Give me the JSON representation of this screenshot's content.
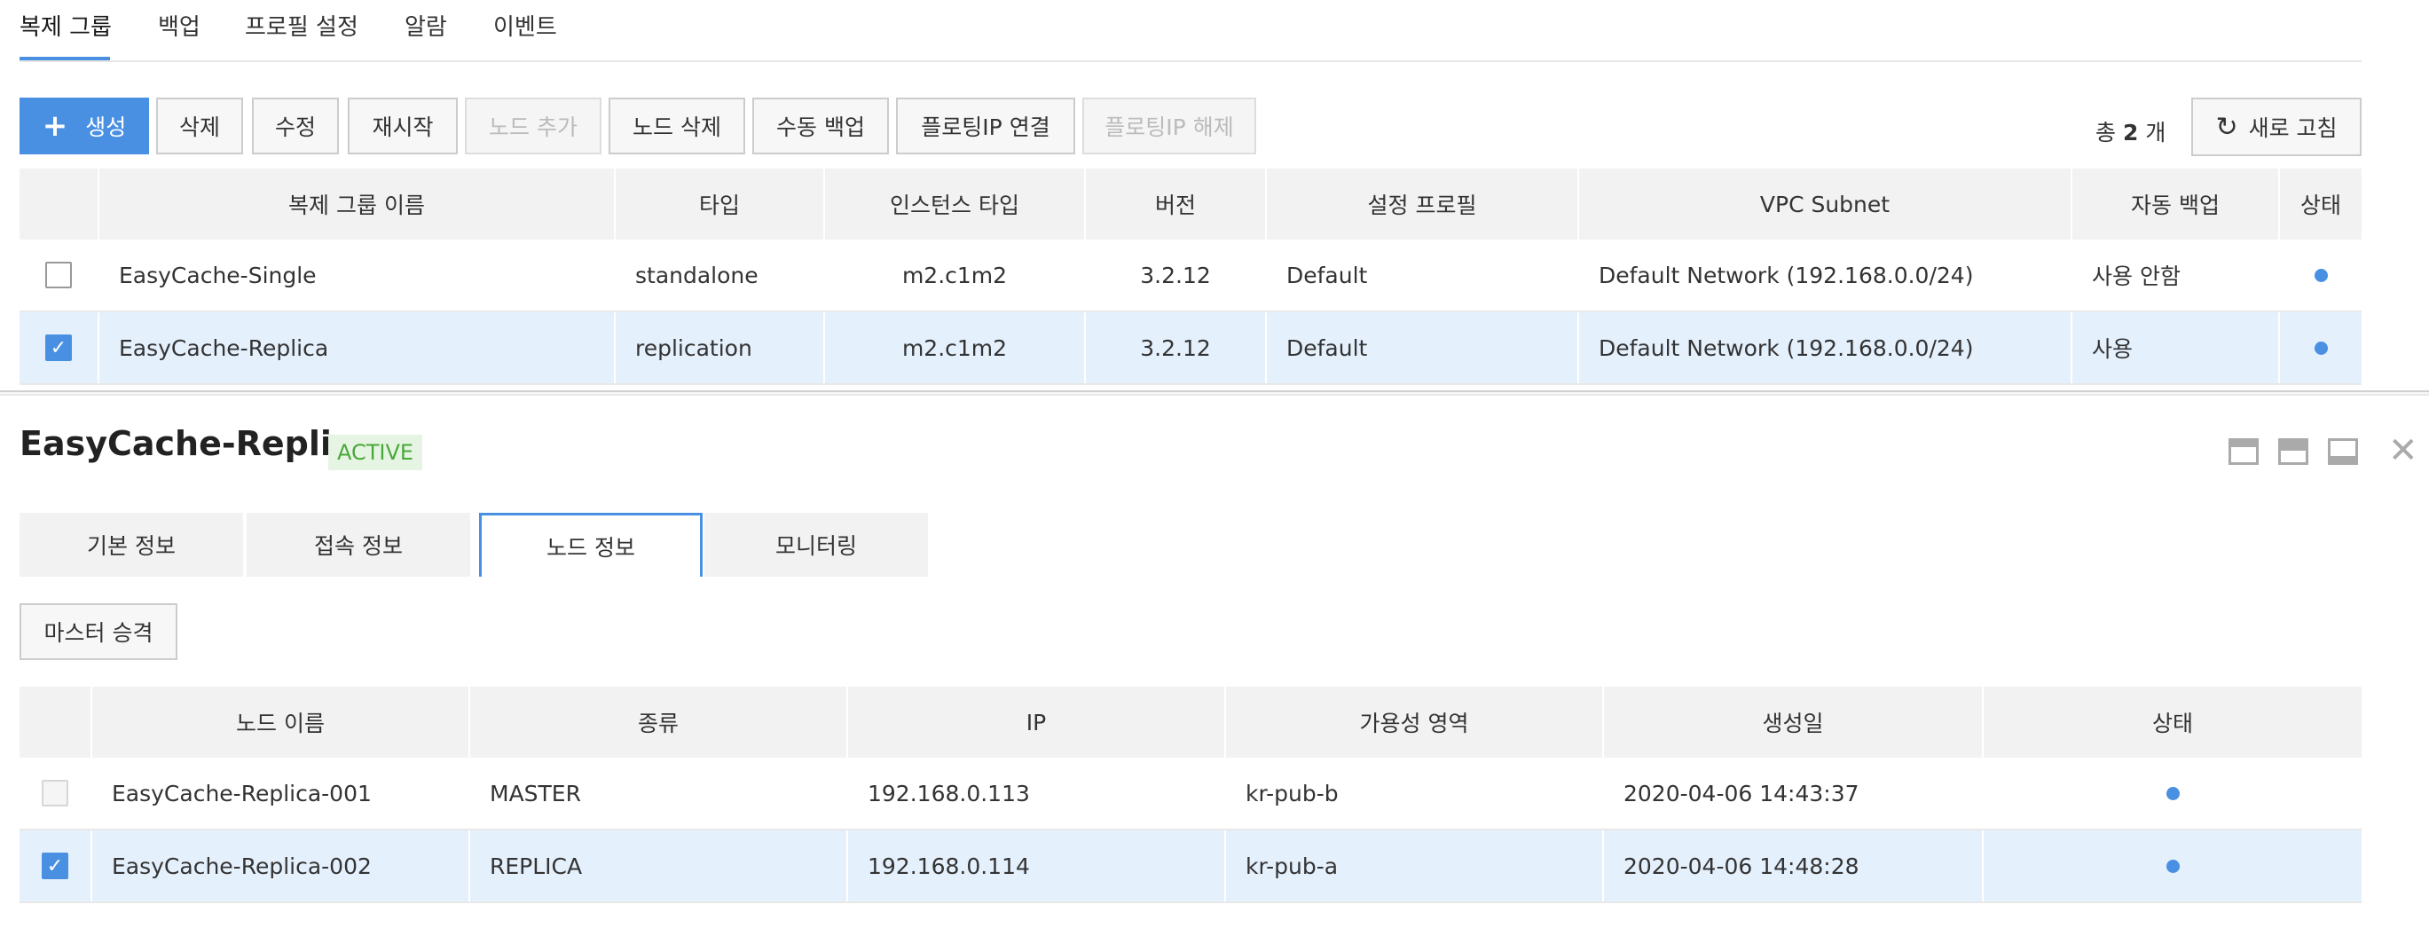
{
  "top_tabs": [
    "복제 그룹",
    "백업",
    "프로필 설정",
    "알람",
    "이벤트"
  ],
  "toolbar": {
    "create": "생성",
    "delete": "삭제",
    "edit": "수정",
    "restart": "재시작",
    "add_node": "노드 추가",
    "delete_node": "노드 삭제",
    "manual_backup": "수동 백업",
    "floating_ip_connect": "플로팅IP 연결",
    "floating_ip_disconnect": "플로팅IP 해제",
    "total_prefix": "총",
    "total_count": "2",
    "total_suffix": "개",
    "refresh": "새로 고침"
  },
  "group_table": {
    "headers": [
      "복제 그룹 이름",
      "타입",
      "인스턴스 타입",
      "버전",
      "설정 프로필",
      "VPC Subnet",
      "자동 백업",
      "상태"
    ],
    "rows": [
      {
        "name": "EasyCache-Single",
        "type": "standalone",
        "instance_type": "m2.c1m2",
        "version": "3.2.12",
        "profile": "Default",
        "subnet": "Default Network (192.168.0.0/24)",
        "auto_backup": "사용 안함",
        "checked": false
      },
      {
        "name": "EasyCache-Replica",
        "type": "replication",
        "instance_type": "m2.c1m2",
        "version": "3.2.12",
        "profile": "Default",
        "subnet": "Default Network (192.168.0.0/24)",
        "auto_backup": "사용",
        "checked": true
      }
    ]
  },
  "detail": {
    "title": "EasyCache-Replica",
    "status": "ACTIVE",
    "tabs": [
      "기본 정보",
      "접속 정보",
      "노드 정보",
      "모니터링"
    ],
    "active_tab": "노드 정보",
    "promote_button": "마스터 승격"
  },
  "node_table": {
    "headers": [
      "노드 이름",
      "종류",
      "IP",
      "가용성 영역",
      "생성일",
      "상태"
    ],
    "rows": [
      {
        "name": "EasyCache-Replica-001",
        "kind": "MASTER",
        "ip": "192.168.0.113",
        "zone": "kr-pub-b",
        "created": "2020-04-06 14:43:37",
        "checked": false
      },
      {
        "name": "EasyCache-Replica-002",
        "kind": "REPLICA",
        "ip": "192.168.0.114",
        "zone": "kr-pub-a",
        "created": "2020-04-06 14:48:28",
        "checked": true
      }
    ]
  },
  "colors": {
    "accent": "#4a90e2",
    "active_badge": "#4aa83a",
    "selected_row": "#e5f0fd"
  }
}
